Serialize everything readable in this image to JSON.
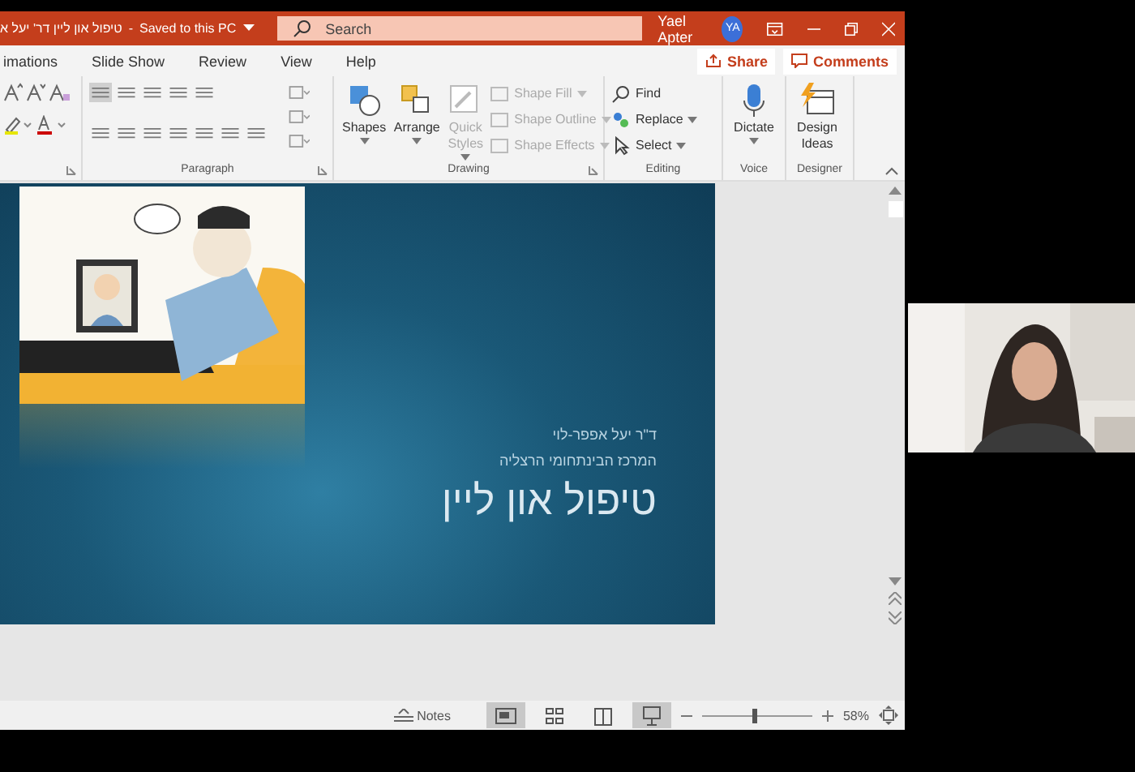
{
  "window": {
    "title": "טיפול און ליין דר' יעל א",
    "separator": "-",
    "save_status": "Saved to this PC",
    "search": {
      "placeholder": "Search"
    },
    "user": {
      "name": "Yael Apter",
      "initials": "YA"
    }
  },
  "ribbon_tabs": [
    {
      "label": "imations",
      "selected": false
    },
    {
      "label": "Slide Show",
      "selected": false
    },
    {
      "label": "Review",
      "selected": false
    },
    {
      "label": "View",
      "selected": false
    },
    {
      "label": "Help",
      "selected": false
    }
  ],
  "share": "Share",
  "comments": "Comments",
  "ribbon_groups": [
    {
      "kind": "font"
    },
    {
      "kind": "paragraph",
      "label": "Paragraph"
    },
    {
      "kind": "drawing",
      "label": "Drawing",
      "items": [
        {
          "kind": "large",
          "label": "Shapes",
          "disabled": false
        },
        {
          "kind": "large",
          "label": "Arrange",
          "disabled": false
        },
        {
          "kind": "large",
          "label": "Quick Styles",
          "disabled": true
        },
        {
          "kind": "small",
          "label": "Shape Fill",
          "disabled": true
        },
        {
          "kind": "small",
          "label": "Shape Outline",
          "disabled": true
        },
        {
          "kind": "small",
          "label": "Shape Effects",
          "disabled": true
        }
      ]
    },
    {
      "kind": "editing",
      "label": "Editing",
      "items": [
        {
          "kind": "small",
          "label": "Find",
          "disabled": false
        },
        {
          "kind": "small",
          "label": "Replace",
          "disabled": false
        },
        {
          "kind": "small",
          "label": "Select",
          "disabled": false
        }
      ]
    },
    {
      "kind": "voice",
      "label": "Voice",
      "items": [
        {
          "kind": "large",
          "label": "Dictate",
          "disabled": false
        }
      ]
    },
    {
      "kind": "designer",
      "label": "Designer",
      "items": [
        {
          "kind": "large",
          "label": "Design Ideas",
          "disabled": false
        }
      ]
    }
  ],
  "slide": {
    "subtitle_lines": [
      "ד\"ר יעל אפפר-לוי",
      "המרכז הבינתחומי הרצליה"
    ],
    "title": "טיפול און ליין"
  },
  "status_bar": {
    "notes": "Notes",
    "views": [
      {
        "selected": true
      },
      {
        "selected": false
      },
      {
        "selected": false
      },
      {
        "selected": true
      }
    ],
    "zoom": {
      "level": 0.45,
      "reading": "58%"
    }
  }
}
